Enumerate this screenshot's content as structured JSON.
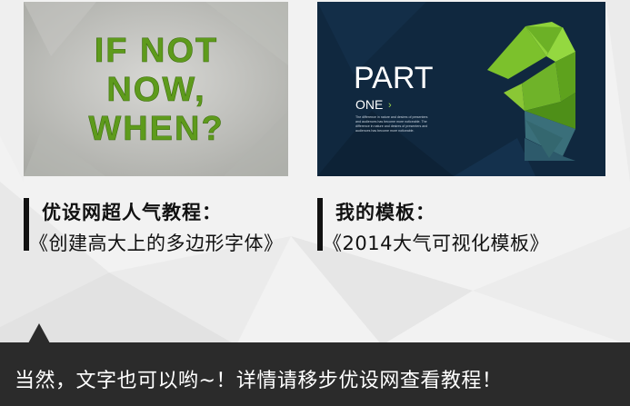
{
  "cards": [
    {
      "image_lines": [
        "IF NOT",
        "NOW,",
        "WHEN?"
      ],
      "caption_title": "优设网超人气教程：",
      "caption_subtitle": "《创建高大上的多边形字体》"
    },
    {
      "image_title": "PART",
      "image_subtitle": "ONE",
      "image_body": [
        "The difference in nature and desires of presenters",
        "and audiences has become more noticeable. The",
        "difference in nature and desires of presenters and",
        "audiences has become more noticeable."
      ],
      "image_number": "1",
      "caption_title": "我的模板：",
      "caption_subtitle": "《2014大气可视化模板》"
    }
  ],
  "banner": {
    "text": "当然，文字也可以哟~！详情请移步优设网查看教程！"
  },
  "colors": {
    "green": "#5e9b1c",
    "green_light": "#8fd33a",
    "navy": "#10283f",
    "banner_bg": "#2b2b2b"
  }
}
